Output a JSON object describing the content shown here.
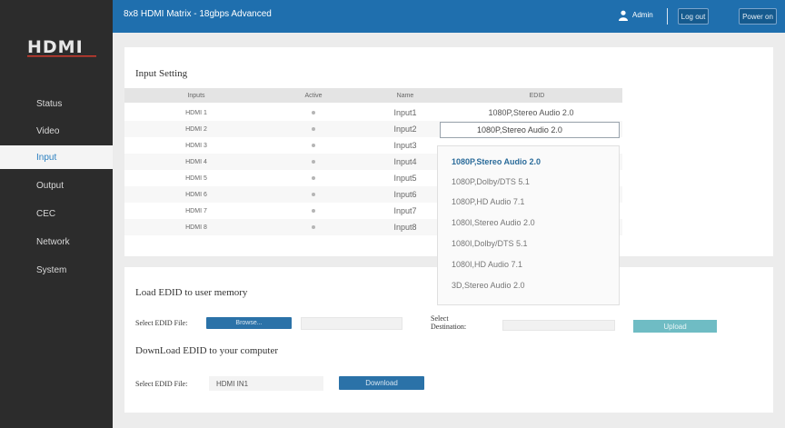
{
  "app": {
    "title": "8x8 HDMI Matrix - 18gbps Advanced",
    "logo": "HDMI",
    "user": "Admin",
    "logout_label": "Log out",
    "power_label": "Power on"
  },
  "sidebar": {
    "items": [
      {
        "label": "Status"
      },
      {
        "label": "Video"
      },
      {
        "label": "Input"
      },
      {
        "label": "Output"
      },
      {
        "label": "CEC"
      },
      {
        "label": "Network"
      },
      {
        "label": "System"
      }
    ],
    "active": "Input"
  },
  "input_setting": {
    "title": "Input Setting",
    "columns": [
      "Inputs",
      "Active",
      "Name",
      "EDID"
    ],
    "rows": [
      {
        "input": "HDMI 1",
        "name": "Input1",
        "edid": "1080P,Stereo Audio 2.0"
      },
      {
        "input": "HDMI 2",
        "name": "Input2",
        "edid": "1080P,Stereo Audio 2.0"
      },
      {
        "input": "HDMI 3",
        "name": "Input3",
        "edid": ""
      },
      {
        "input": "HDMI 4",
        "name": "Input4",
        "edid": ""
      },
      {
        "input": "HDMI 5",
        "name": "Input5",
        "edid": ""
      },
      {
        "input": "HDMI 6",
        "name": "Input6",
        "edid": ""
      },
      {
        "input": "HDMI 7",
        "name": "Input7",
        "edid": ""
      },
      {
        "input": "HDMI 8",
        "name": "Input8",
        "edid": ""
      }
    ],
    "dropdown_options": [
      "1080P,Stereo Audio 2.0",
      "1080P,Dolby/DTS 5.1",
      "1080P,HD Audio 7.1",
      "1080I,Stereo Audio 2.0",
      "1080I,Dolby/DTS 5.1",
      "1080I,HD Audio 7.1",
      "3D,Stereo Audio 2.0"
    ],
    "dropdown_selected": "1080P,Stereo Audio 2.0"
  },
  "load_edid": {
    "title": "Load EDID to user memory",
    "select_file_label": "Select EDID File:",
    "browse_label": "Browse...",
    "destination_label_1": "Select",
    "destination_label_2": "Destination:",
    "upload_label": "Upload"
  },
  "download_edid": {
    "title": "DownLoad EDID to your computer",
    "select_file_label": "Select EDID File:",
    "selected_value": "HDMI IN1",
    "download_label": "Download"
  },
  "colors": {
    "topbar": "#1f6fae",
    "sidebar": "#2c2c2c",
    "accent": "#2a7fc0",
    "upload": "#6fbcc4"
  }
}
